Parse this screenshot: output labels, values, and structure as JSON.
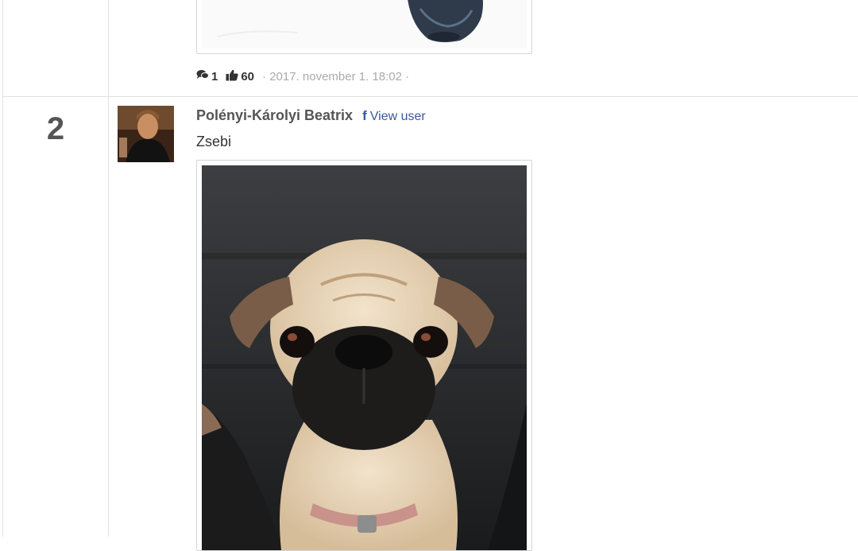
{
  "previous_entry": {
    "comments_count": "1",
    "likes_count": "60",
    "timestamp": "· 2017. november 1. 18:02 ·"
  },
  "entry": {
    "rank": "2",
    "user_name": "Polényi-Károlyi Beatrix",
    "view_user_label": "View user",
    "caption": "Zsebi",
    "avatar_alt": "user avatar",
    "photo_subject": "pug puppy photo"
  },
  "icons": {
    "comments": "comments-icon",
    "likes": "thumbs-up-icon",
    "facebook": "facebook-icon"
  },
  "colors": {
    "link": "#3b5998",
    "border": "#e2e2e2",
    "rank": "#555555",
    "meta": "#aaaaaa"
  }
}
